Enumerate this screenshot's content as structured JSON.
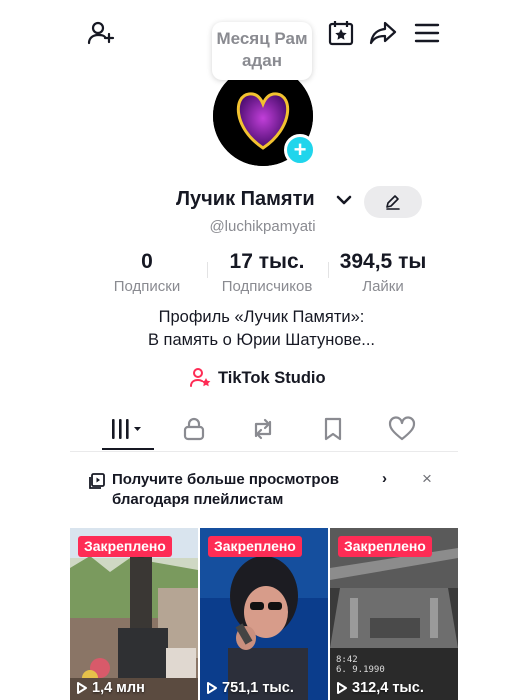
{
  "tooltip": {
    "text": "Месяц Рамадан"
  },
  "profile": {
    "name": "Лучик Памяти",
    "handle": "@luchikpamyati"
  },
  "stats": [
    {
      "value": "0",
      "label": "Подписки"
    },
    {
      "value": "17 тыс.",
      "label": "Подписчиков"
    },
    {
      "value": "394,5 ты",
      "label": "Лайки"
    }
  ],
  "bio": {
    "line1": "Профиль «Лучик Памяти»:",
    "line2": "В память о Юрии Шатунове..."
  },
  "studio": {
    "label": "TikTok Studio"
  },
  "tabs": [
    "videos-grid-icon",
    "lock-icon",
    "repost-icon",
    "bookmark-icon",
    "heart-icon"
  ],
  "banner": {
    "line1": "Получите больше просмотров",
    "line2": "благодаря плейлистам",
    "arrow": "›",
    "close": "×"
  },
  "videos": [
    {
      "pinned": "Закреплено",
      "views": "1,4 млн"
    },
    {
      "pinned": "Закреплено",
      "views": "751,1 тыс."
    },
    {
      "pinned": "Закреплено",
      "views": "312,4 тыс."
    }
  ],
  "colors": {
    "accent": "#fe2c55",
    "cyan": "#20d5ec",
    "text": "#161823",
    "muted": "#8a8b91"
  }
}
